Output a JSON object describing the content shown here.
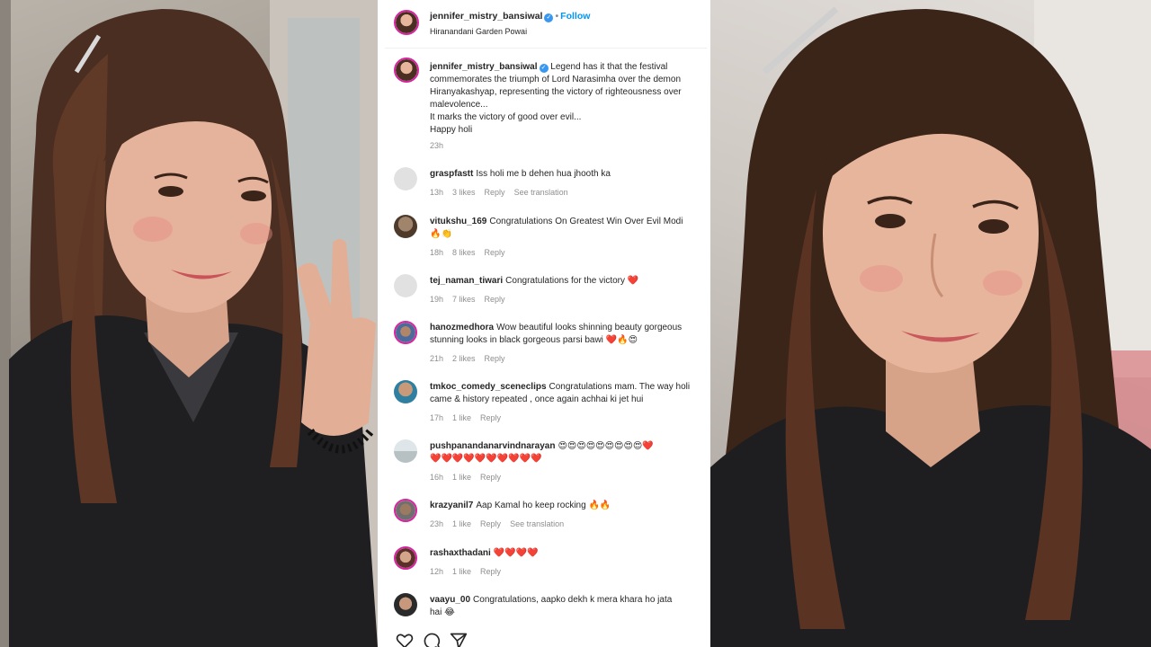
{
  "post": {
    "username": "jennifer_mistry_bansiwal",
    "follow_label": "Follow",
    "location": "Hiranandani Garden Powai",
    "caption_lines": [
      "Legend has it that the festival",
      "commemorates the triumph of Lord Narasimha over the demon",
      "Hiranyakashyap, representing the victory of righteousness over",
      "malevolence...",
      "It marks the victory of good over evil...",
      "Happy holi"
    ],
    "caption_time": "23h",
    "verified_icon": "verified-badge-icon"
  },
  "comments": [
    {
      "user": "graspfastt",
      "lines": [
        "Iss holi me b dehen hua jhooth ka"
      ],
      "time": "13h",
      "likes": "3 likes",
      "reply": "Reply",
      "translate": "See translation"
    },
    {
      "user": "vitukshu_169",
      "lines": [
        "Congratulations On Greatest Win Over Evil Modi",
        "🔥👏"
      ],
      "time": "18h",
      "likes": "8 likes",
      "reply": "Reply",
      "translate": ""
    },
    {
      "user": "tej_naman_tiwari",
      "lines": [
        "Congratulations for the victory ❤️"
      ],
      "time": "19h",
      "likes": "7 likes",
      "reply": "Reply",
      "translate": ""
    },
    {
      "user": "hanozmedhora",
      "lines": [
        "Wow beautiful looks shinning beauty gorgeous",
        "stunning looks in black gorgeous parsi bawi ❤️🔥😍"
      ],
      "time": "21h",
      "likes": "2 likes",
      "reply": "Reply",
      "translate": ""
    },
    {
      "user": "tmkoc_comedy_sceneclips",
      "lines": [
        "Congratulations mam. The way holi",
        "came & history repeated , once again achhai ki jet hui"
      ],
      "time": "17h",
      "likes": "1 like",
      "reply": "Reply",
      "translate": ""
    },
    {
      "user": "pushpanandanarvindnarayan",
      "lines": [
        "😍😍😍😍😍😍😍😍😍❤️",
        "❤️❤️❤️❤️❤️❤️❤️❤️❤️❤️"
      ],
      "time": "16h",
      "likes": "1 like",
      "reply": "Reply",
      "translate": ""
    },
    {
      "user": "krazyanil7",
      "lines": [
        "Aap Kamal ho keep rocking 🔥🔥"
      ],
      "time": "23h",
      "likes": "1 like",
      "reply": "Reply",
      "translate": "See translation"
    },
    {
      "user": "rashaxthadani",
      "lines": [
        "❤️❤️❤️❤️"
      ],
      "time": "12h",
      "likes": "1 like",
      "reply": "Reply",
      "translate": ""
    },
    {
      "user": "vaayu_00",
      "lines": [
        "Congratulations, aapko dekh k mera khara ho jata",
        "hai 😂"
      ],
      "time": "",
      "likes": "",
      "reply": "",
      "translate": ""
    }
  ],
  "action_icons": [
    "heart-outline-icon",
    "comment-icon",
    "share-icon"
  ],
  "colors": {
    "accent": "#0095f6",
    "verified": "#3897f0",
    "story_ring": "#d6249f",
    "heart": "#e0245e",
    "muted": "#8e8e8e"
  }
}
